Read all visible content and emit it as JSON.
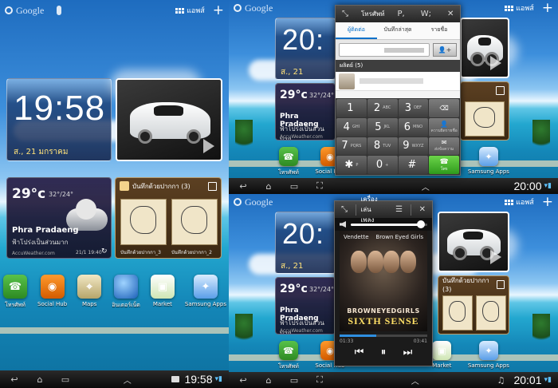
{
  "google_label": "Google",
  "apps_label": "แอพส์",
  "clock": {
    "time": "19:58",
    "date": "ส., 21 มกราคม"
  },
  "clock_partial": "20:",
  "weather": {
    "temp": "29°c",
    "range": "32°/24°",
    "city": "Phra Pradaeng",
    "condition": "ฟ้าโปร่งเป็นส่วนมาก",
    "brand": "AccuWeather.com",
    "stamp": "21/1 19:40"
  },
  "memo": {
    "title": "บันทึกด้วยปากกา (3)",
    "note1": "บันทึกด้วยปากกา_3",
    "note2": "บันทึกด้วยปากกา_2"
  },
  "dock": [
    {
      "label": "โทรศัพท์",
      "glyph": "☎"
    },
    {
      "label": "Social Hub",
      "glyph": "◉"
    },
    {
      "label": "Maps",
      "glyph": "⌖"
    },
    {
      "label": "อินเตอร์เน็ต",
      "glyph": ""
    },
    {
      "label": "Market",
      "glyph": "▣"
    },
    {
      "label": "Samsung Apps",
      "glyph": "✦"
    }
  ],
  "status": {
    "left_time": "19:58",
    "tr_time": "20:00",
    "br_time": "20:01"
  },
  "phone": {
    "title": "โทรศัพท์",
    "btn_p": "P,",
    "btn_w": "W;",
    "tabs": [
      "ผู้ติดต่อ",
      "บันทึกล่าสุด",
      "รายชื่อ"
    ],
    "group": "ผลิตย์ (5)",
    "keys": [
      {
        "d": "1",
        "s": ""
      },
      {
        "d": "2",
        "s": "ABC"
      },
      {
        "d": "3",
        "s": "DEF"
      },
      {
        "d": "⌫",
        "s": ""
      },
      {
        "d": "4",
        "s": "GHI"
      },
      {
        "d": "5",
        "s": "JKL"
      },
      {
        "d": "6",
        "s": "MNO"
      },
      {
        "d": "",
        "s": "ความยิดรายชื่อ"
      },
      {
        "d": "7",
        "s": "PQRS"
      },
      {
        "d": "8",
        "s": "TUV"
      },
      {
        "d": "9",
        "s": "WXYZ"
      },
      {
        "d": "✉",
        "s": "ส่งข้อความ"
      },
      {
        "d": "✱",
        "s": "P"
      },
      {
        "d": "0",
        "s": "+"
      },
      {
        "d": "#",
        "s": ""
      },
      {
        "d": "☎",
        "s": "โทร"
      }
    ]
  },
  "music": {
    "title": "เครื่องเล่นเพลง",
    "artist_left": "Vendette",
    "artist_right": "Brown Eyed Girls",
    "band": "BROWNEYEDGIRLS",
    "album": "SIXTH SENSE",
    "elapsed": "01:33",
    "total": "03:41",
    "progress": 0.42,
    "volume": 0.92
  }
}
